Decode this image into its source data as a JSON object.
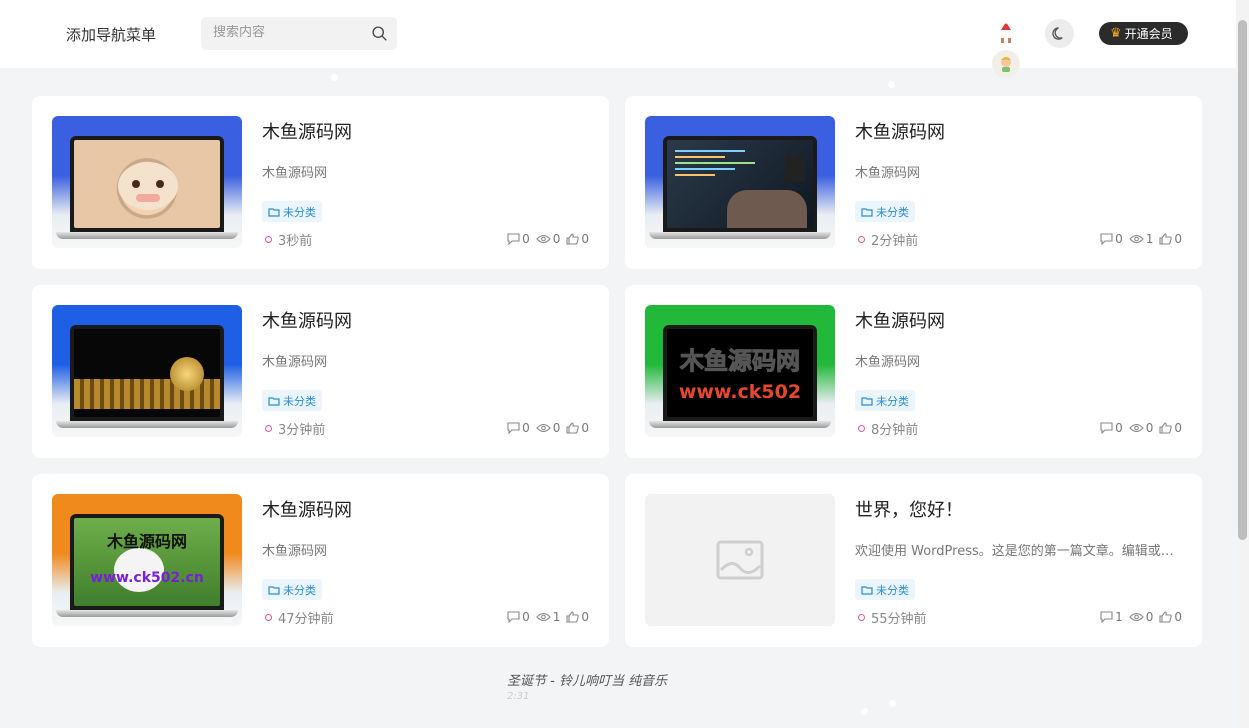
{
  "header": {
    "nav_label": "添加导航菜单",
    "search_placeholder": "搜索内容",
    "vip_label": "开通会员"
  },
  "posts": [
    {
      "title": "木鱼源码网",
      "excerpt": "木鱼源码网",
      "category": "未分类",
      "time": "3秒前",
      "comments": "0",
      "views": "0",
      "likes": "0",
      "thumb": "ox",
      "accent": "#3a5fe0"
    },
    {
      "title": "木鱼源码网",
      "excerpt": "木鱼源码网",
      "category": "未分类",
      "time": "2分钟前",
      "comments": "0",
      "views": "1",
      "likes": "0",
      "thumb": "code",
      "accent": "#3a5fe0"
    },
    {
      "title": "木鱼源码网",
      "excerpt": "木鱼源码网",
      "category": "未分类",
      "time": "3分钟前",
      "comments": "0",
      "views": "0",
      "likes": "0",
      "thumb": "coins",
      "accent": "#1f5fe6"
    },
    {
      "title": "木鱼源码网",
      "excerpt": "木鱼源码网",
      "category": "未分类",
      "time": "8分钟前",
      "comments": "0",
      "views": "0",
      "likes": "0",
      "thumb": "text",
      "screen_line1": "木鱼源码网",
      "screen_line2": "www.ck502",
      "accent": "#22b83a"
    },
    {
      "title": "木鱼源码网",
      "excerpt": "木鱼源码网",
      "category": "未分类",
      "time": "47分钟前",
      "comments": "0",
      "views": "1",
      "likes": "0",
      "thumb": "dog",
      "screen_line1": "木鱼源码网",
      "screen_line2": "www.ck502.cn",
      "accent": "#f08a1c"
    },
    {
      "title": "世界，您好！",
      "excerpt": "欢迎使用 WordPress。这是您的第一篇文章。编辑或删除它，然后开始写作吧！",
      "category": "未分类",
      "time": "55分钟前",
      "comments": "1",
      "views": "0",
      "likes": "0",
      "thumb": "placeholder"
    }
  ],
  "footer": {
    "music": "圣诞节 - 铃儿响叮当 纯音乐",
    "sub": "2:31"
  }
}
